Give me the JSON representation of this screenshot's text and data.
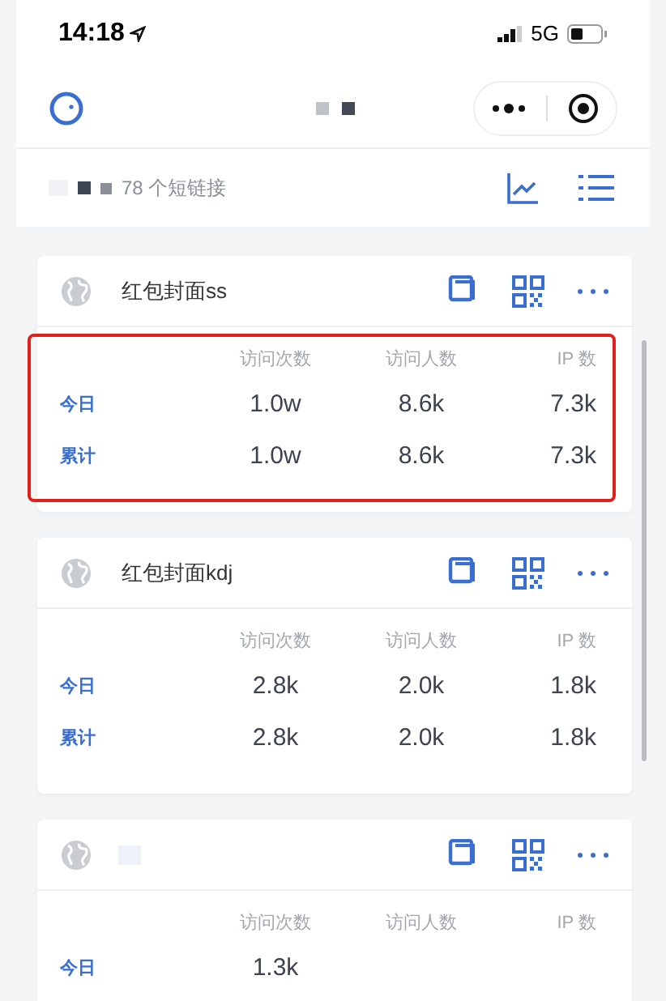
{
  "status_bar": {
    "time": "14:18",
    "network": "5G"
  },
  "header": {
    "count_text": "78 个短链接"
  },
  "cards": [
    {
      "title": "红包封面ss",
      "title_redacted": false,
      "highlighted": true,
      "columns": [
        "访问次数",
        "访问人数",
        "IP 数"
      ],
      "rows": [
        {
          "label": "今日",
          "values": [
            "1.0w",
            "8.6k",
            "7.3k"
          ]
        },
        {
          "label": "累计",
          "values": [
            "1.0w",
            "8.6k",
            "7.3k"
          ]
        }
      ]
    },
    {
      "title": "红包封面kdj",
      "title_redacted": false,
      "highlighted": false,
      "columns": [
        "访问次数",
        "访问人数",
        "IP 数"
      ],
      "rows": [
        {
          "label": "今日",
          "values": [
            "2.8k",
            "2.0k",
            "1.8k"
          ]
        },
        {
          "label": "累计",
          "values": [
            "2.8k",
            "2.0k",
            "1.8k"
          ]
        }
      ]
    },
    {
      "title_redacted": true,
      "highlighted": false,
      "columns": [
        "访问次数",
        "访问人数",
        "IP 数"
      ],
      "rows": [
        {
          "label": "今日",
          "values": [
            "1.3k"
          ]
        }
      ]
    }
  ]
}
